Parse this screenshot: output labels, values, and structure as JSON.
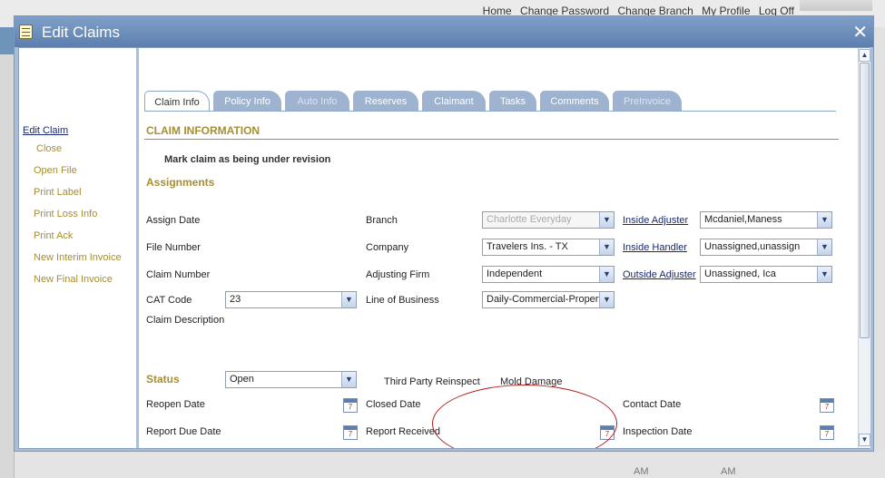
{
  "top_nav": [
    "Home",
    "Change Password",
    "Change Branch",
    "My Profile",
    "Log Off"
  ],
  "modal": {
    "title": "Edit Claims",
    "close_glyph": "✕"
  },
  "left_menu": {
    "edit_claim": "Edit Claim",
    "items": [
      "Close",
      "Open File",
      "Print Label",
      "Print Loss Info",
      "Print Ack",
      "New Interim Invoice",
      "New Final Invoice"
    ]
  },
  "tabs": [
    {
      "label": "Claim Info",
      "state": "active"
    },
    {
      "label": "Policy Info",
      "state": "normal"
    },
    {
      "label": "Auto Info",
      "state": "disabled"
    },
    {
      "label": "Reserves",
      "state": "normal"
    },
    {
      "label": "Claimant",
      "state": "normal"
    },
    {
      "label": "Tasks",
      "state": "normal"
    },
    {
      "label": "Comments",
      "state": "normal"
    },
    {
      "label": "PreInvoice",
      "state": "disabled"
    }
  ],
  "claim_information": {
    "heading": "CLAIM INFORMATION",
    "mark_revision": "Mark claim as being under revision"
  },
  "assignments": {
    "heading": "Assignments",
    "assign_date_label": "Assign Date",
    "file_number_label": "File Number",
    "claim_number_label": "Claim Number",
    "cat_code_label": "CAT Code",
    "cat_code_value": "23",
    "claim_description_label": "Claim Description",
    "branch_label": "Branch",
    "branch_value": "Charlotte Everyday",
    "company_label": "Company",
    "company_value": "Travelers Ins. - TX",
    "adjusting_firm_label": "Adjusting Firm",
    "adjusting_firm_value": "Independent",
    "line_of_business_label": "Line of Business",
    "line_of_business_value": "Daily-Commercial-Propert",
    "inside_adjuster_label": "Inside Adjuster",
    "inside_adjuster_value": "Mcdaniel,Maness",
    "inside_handler_label": "Inside Handler",
    "inside_handler_value": "Unassigned,unassign",
    "outside_adjuster_label": "Outside Adjuster",
    "outside_adjuster_value": "Unassigned, Ica"
  },
  "status": {
    "heading": "Status",
    "status_value": "Open",
    "third_party_reinspect": "Third Party Reinspect",
    "mold_damage": "Mold Damage",
    "reopen_date_label": "Reopen Date",
    "closed_date_label": "Closed Date",
    "contact_date_label": "Contact Date",
    "report_due_date_label": "Report Due Date",
    "report_received_label": "Report Received",
    "inspection_date_label": "Inspection Date"
  },
  "calendar_day": "7",
  "bg_bottom": [
    "AM",
    "AM"
  ],
  "colors": {
    "title_bar": "#6d8fbb",
    "accent_gold": "#a58e33",
    "link_blue": "#1a2a6c",
    "annotation_red": "#b31d1d"
  }
}
